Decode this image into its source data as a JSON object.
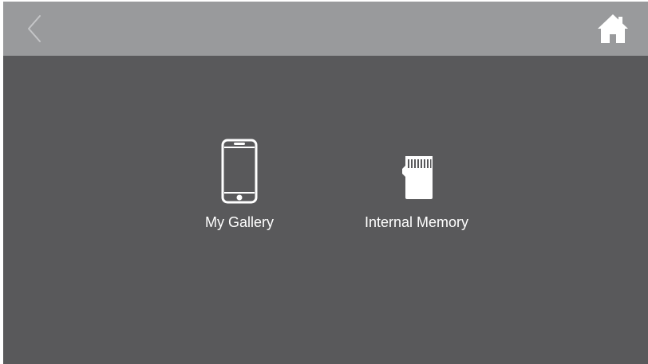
{
  "header": {
    "back_icon": "chevron-left-icon",
    "home_icon": "home-icon"
  },
  "main": {
    "tiles": [
      {
        "label": "My Gallery",
        "icon": "smartphone-icon"
      },
      {
        "label": "Internal Memory",
        "icon": "sd-card-icon"
      }
    ]
  },
  "colors": {
    "background": "#59595b",
    "topbar": "#999a9c",
    "foreground": "#ffffff",
    "back_chevron": "#c4c5c7"
  }
}
